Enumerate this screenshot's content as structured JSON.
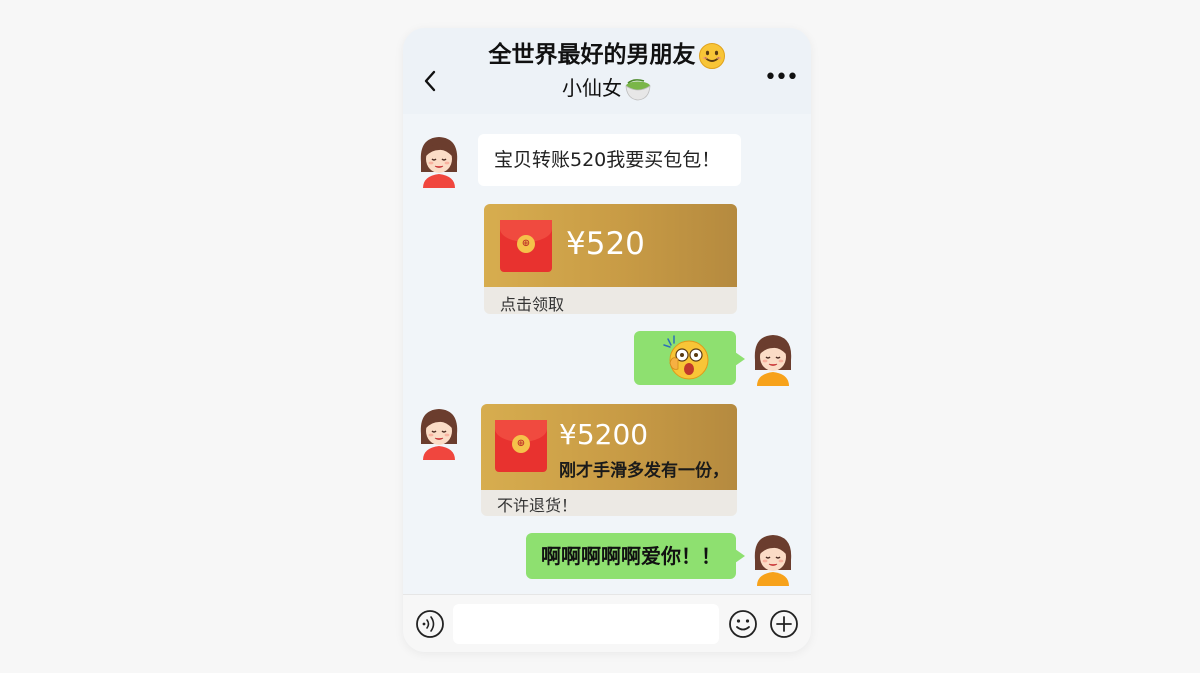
{
  "header": {
    "title": "全世界最好的男朋友",
    "subtitle": "小仙女",
    "title_emoji": "smiling-face-emoji",
    "subtitle_emoji": "tea-bowl-emoji"
  },
  "messages": [
    {
      "side": "left",
      "type": "text",
      "text": "宝贝转账520我要买包包！"
    },
    {
      "side": "left",
      "type": "red_packet",
      "amount": "¥520",
      "note": "",
      "footer": "点击领取"
    },
    {
      "side": "right",
      "type": "emoji",
      "emoji": "shocked-face-emoji"
    },
    {
      "side": "left",
      "type": "red_packet",
      "amount": "¥5200",
      "note": "刚才手滑多发有一份，",
      "footer": "不许退货！"
    },
    {
      "side": "right",
      "type": "text",
      "text": "啊啊啊啊啊爱你！！"
    }
  ],
  "input": {
    "placeholder": ""
  },
  "colors": {
    "green_bubble": "#8ee070",
    "red_packet_gold": "#c89b45",
    "envelope_red": "#e8322f"
  }
}
